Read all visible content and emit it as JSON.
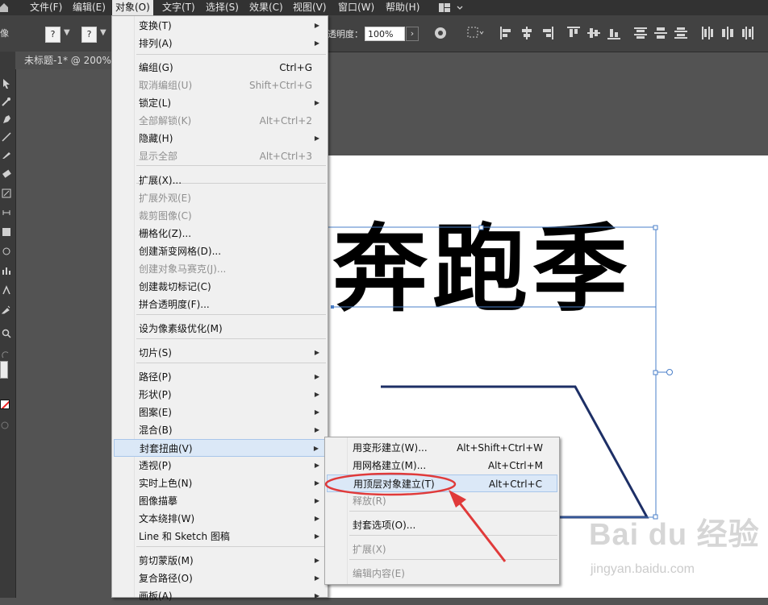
{
  "menubar": {
    "items": [
      {
        "label": "文件(F)"
      },
      {
        "label": "编辑(E)"
      },
      {
        "label": "对象(O)"
      },
      {
        "label": "文字(T)"
      },
      {
        "label": "选择(S)"
      },
      {
        "label": "效果(C)"
      },
      {
        "label": "视图(V)"
      },
      {
        "label": "窗口(W)"
      },
      {
        "label": "帮助(H)"
      }
    ]
  },
  "control_bar": {
    "left_label": "像",
    "dropdown1": "?",
    "dropdown2": "?",
    "opacity_label": "透明度：",
    "opacity_value": "100%"
  },
  "document": {
    "tab_title": "未标题-1* @ 200%"
  },
  "artwork": {
    "headline": "奔跑季"
  },
  "object_menu": {
    "items": [
      {
        "label": "变换(T)",
        "shortcut": "",
        "submenu": true,
        "disabled": false
      },
      {
        "label": "排列(A)",
        "shortcut": "",
        "submenu": true,
        "disabled": false
      },
      {
        "label": "编组(G)",
        "shortcut": "Ctrl+G",
        "submenu": false,
        "disabled": false
      },
      {
        "label": "取消编组(U)",
        "shortcut": "Shift+Ctrl+G",
        "submenu": false,
        "disabled": true
      },
      {
        "label": "锁定(L)",
        "shortcut": "",
        "submenu": true,
        "disabled": false
      },
      {
        "label": "全部解锁(K)",
        "shortcut": "Alt+Ctrl+2",
        "submenu": false,
        "disabled": true
      },
      {
        "label": "隐藏(H)",
        "shortcut": "",
        "submenu": true,
        "disabled": false
      },
      {
        "label": "显示全部",
        "shortcut": "Alt+Ctrl+3",
        "submenu": false,
        "disabled": true
      },
      {
        "label": "扩展(X)...",
        "shortcut": "",
        "submenu": false,
        "disabled": false
      },
      {
        "label": "扩展外观(E)",
        "shortcut": "",
        "submenu": false,
        "disabled": true
      },
      {
        "label": "裁剪图像(C)",
        "shortcut": "",
        "submenu": false,
        "disabled": true
      },
      {
        "label": "栅格化(Z)...",
        "shortcut": "",
        "submenu": false,
        "disabled": false
      },
      {
        "label": "创建渐变网格(D)...",
        "shortcut": "",
        "submenu": false,
        "disabled": false
      },
      {
        "label": "创建对象马赛克(J)...",
        "shortcut": "",
        "submenu": false,
        "disabled": true
      },
      {
        "label": "创建裁切标记(C)",
        "shortcut": "",
        "submenu": false,
        "disabled": false
      },
      {
        "label": "拼合透明度(F)...",
        "shortcut": "",
        "submenu": false,
        "disabled": false
      },
      {
        "label": "设为像素级优化(M)",
        "shortcut": "",
        "submenu": false,
        "disabled": false
      },
      {
        "label": "切片(S)",
        "shortcut": "",
        "submenu": true,
        "disabled": false
      },
      {
        "label": "路径(P)",
        "shortcut": "",
        "submenu": true,
        "disabled": false
      },
      {
        "label": "形状(P)",
        "shortcut": "",
        "submenu": true,
        "disabled": false
      },
      {
        "label": "图案(E)",
        "shortcut": "",
        "submenu": true,
        "disabled": false
      },
      {
        "label": "混合(B)",
        "shortcut": "",
        "submenu": true,
        "disabled": false
      },
      {
        "label": "封套扭曲(V)",
        "shortcut": "",
        "submenu": true,
        "disabled": false,
        "highlighted": true
      },
      {
        "label": "透视(P)",
        "shortcut": "",
        "submenu": true,
        "disabled": false
      },
      {
        "label": "实时上色(N)",
        "shortcut": "",
        "submenu": true,
        "disabled": false
      },
      {
        "label": "图像描摹",
        "shortcut": "",
        "submenu": true,
        "disabled": false
      },
      {
        "label": "文本绕排(W)",
        "shortcut": "",
        "submenu": true,
        "disabled": false
      },
      {
        "label": "Line 和 Sketch 图稿",
        "shortcut": "",
        "submenu": true,
        "disabled": false
      },
      {
        "label": "剪切蒙版(M)",
        "shortcut": "",
        "submenu": true,
        "disabled": false
      },
      {
        "label": "复合路径(O)",
        "shortcut": "",
        "submenu": true,
        "disabled": false
      },
      {
        "label": "画板(A)",
        "shortcut": "",
        "submenu": true,
        "disabled": false
      }
    ]
  },
  "envelope_submenu": {
    "items": [
      {
        "label": "用变形建立(W)...",
        "shortcut": "Alt+Shift+Ctrl+W",
        "disabled": false
      },
      {
        "label": "用网格建立(M)...",
        "shortcut": "Alt+Ctrl+M",
        "disabled": false
      },
      {
        "label": "用顶层对象建立(T)",
        "shortcut": "Alt+Ctrl+C",
        "disabled": false,
        "highlighted": true
      },
      {
        "label": "释放(R)",
        "shortcut": "",
        "disabled": true
      },
      {
        "label": "封套选项(O)...",
        "shortcut": "",
        "disabled": false
      },
      {
        "label": "扩展(X)",
        "shortcut": "",
        "disabled": true
      },
      {
        "label": "编辑内容(E)",
        "shortcut": "",
        "disabled": true
      }
    ]
  },
  "watermark": {
    "logo": "Bai du 经验",
    "url": "jingyan.baidu.com"
  },
  "colors": {
    "selection_blue": "#4a7fc8",
    "annotation_red": "#e03a3a",
    "menu_highlight": "#dbe8f7",
    "menubar_bg": "#323232"
  }
}
